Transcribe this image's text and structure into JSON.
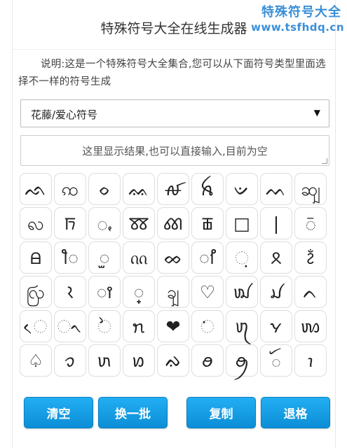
{
  "watermark": {
    "name": "特殊符号大全",
    "url": "www.tsfhdq.cn"
  },
  "header": {
    "title": "特殊符号大全在线生成器"
  },
  "description": "说明:这是一个特殊符号大全集合,您可以从下面符号类型里面选择不一样的符号生成",
  "category_select": {
    "selected": "花藤/爱心符号"
  },
  "result_box": {
    "placeholder": "这里显示结果,也可以直接输入,目前为空"
  },
  "symbols": [
    "ᨒ",
    "ꩡ",
    "ᨔ",
    "ᨐ",
    "ꫛ",
    "ꫝ",
    "ᨉ",
    "ᨓ",
    "ꩿ",
    "ꩮ",
    "ꫨ",
    "ꩻ",
    "ꫩ",
    "ꫤ",
    "ꫥ",
    "□",
    "|",
    "ꩼ",
    "ꫪ",
    "ꫫ",
    "ꫬ",
    "ᦶ",
    "ᨖ",
    "ꫯ",
    "ᨘ",
    "ꫳ",
    "ꫲ",
    "ꩺ",
    "ꫴ",
    "ꫵ",
    "꫶",
    "ꩾ",
    "♡",
    "ꪢ",
    "ꪣ",
    "ᨈ",
    "ᨙ",
    "ᨚ",
    "ᨛ",
    "ꪦ",
    "❤",
    "ᨗ",
    "ꪨ",
    "ꪩ",
    "ꪪ",
    "♤",
    "ꪫ",
    "ꪬ",
    "ꪭ",
    "ᨁ",
    "ꪮ",
    "ꪯ",
    "ꪰ",
    "ꪱ"
  ],
  "buttons": {
    "clear": "清空",
    "next_batch": "换一批",
    "copy": "复制",
    "backspace": "退格"
  },
  "colors": {
    "button": "#1a9de5",
    "watermark": "#3a8fd8"
  }
}
